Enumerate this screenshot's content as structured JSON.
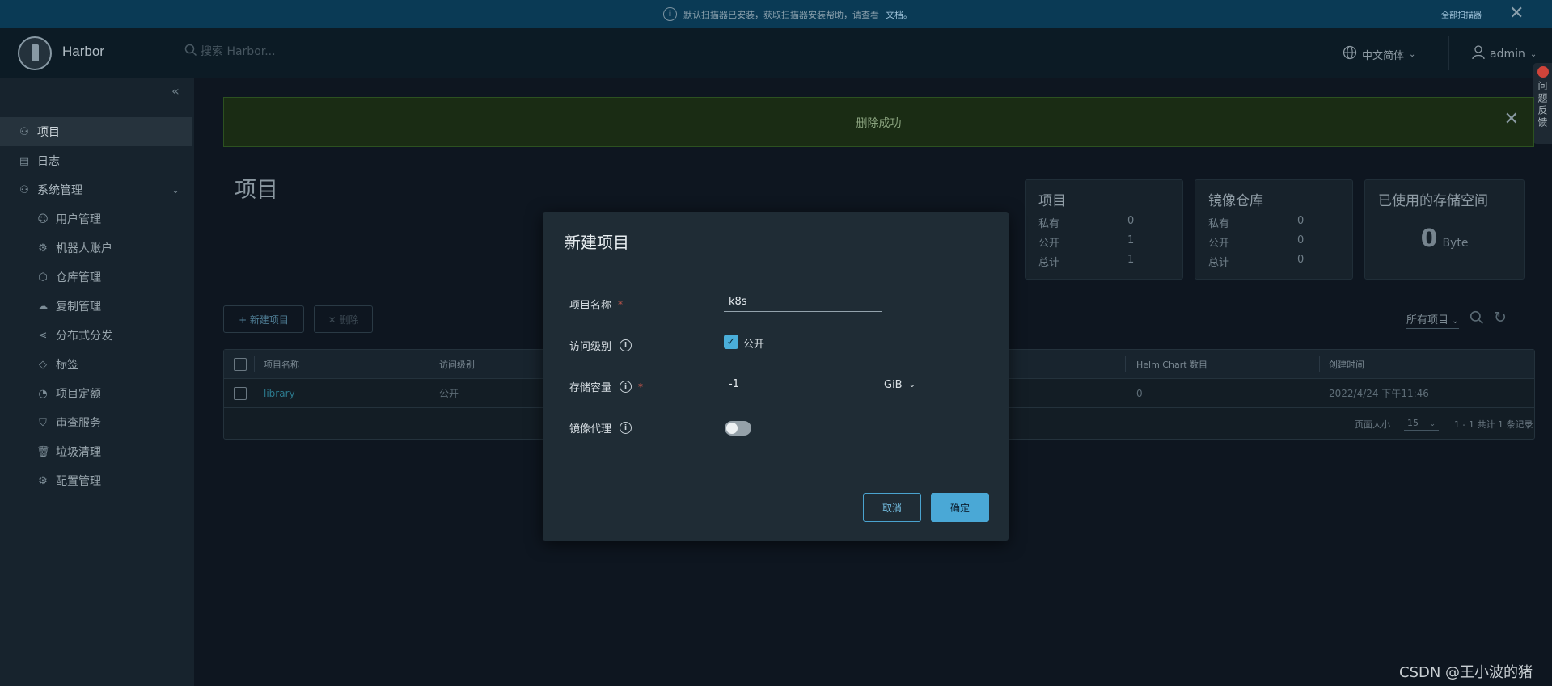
{
  "notice": {
    "message": "默认扫描器已安装，获取扫描器安装帮助，请查看",
    "doc_link": "文档。",
    "install_link": "全部扫描器"
  },
  "header": {
    "brand": "Harbor",
    "search_placeholder": "搜索 Harbor...",
    "language": "中文简体",
    "user": "admin"
  },
  "feedback": {
    "label": "问题反馈"
  },
  "sidebar": {
    "items": [
      {
        "label": "项目",
        "icon": "projects-icon",
        "active": true
      },
      {
        "label": "日志",
        "icon": "log-icon"
      },
      {
        "label": "系统管理",
        "icon": "admin-icon",
        "expandable": true
      }
    ],
    "sub_items": [
      {
        "label": "用户管理",
        "icon": "users-icon"
      },
      {
        "label": "机器人账户",
        "icon": "robot-icon"
      },
      {
        "label": "仓库管理",
        "icon": "registry-icon"
      },
      {
        "label": "复制管理",
        "icon": "replication-icon"
      },
      {
        "label": "分布式分发",
        "icon": "distribution-icon"
      },
      {
        "label": "标签",
        "icon": "tag-icon"
      },
      {
        "label": "项目定额",
        "icon": "quota-icon"
      },
      {
        "label": "审查服务",
        "icon": "shield-icon"
      },
      {
        "label": "垃圾清理",
        "icon": "trash-icon"
      },
      {
        "label": "配置管理",
        "icon": "gear-icon"
      }
    ]
  },
  "alert": {
    "message": "删除成功"
  },
  "page": {
    "title": "项目"
  },
  "cards": {
    "projects": {
      "title": "项目",
      "rows": [
        {
          "label": "私有",
          "value": "0"
        },
        {
          "label": "公开",
          "value": "1"
        },
        {
          "label": "总计",
          "value": "1"
        }
      ]
    },
    "repos": {
      "title": "镜像仓库",
      "rows": [
        {
          "label": "私有",
          "value": "0"
        },
        {
          "label": "公开",
          "value": "0"
        },
        {
          "label": "总计",
          "value": "0"
        }
      ]
    },
    "storage": {
      "title": "已使用的存储空间",
      "value": "0",
      "unit": "Byte"
    }
  },
  "toolbar": {
    "new_project": "+ 新建项目",
    "delete": "✕ 删除",
    "filter": "所有项目"
  },
  "table": {
    "headers": {
      "name": "项目名称",
      "access": "访问级别",
      "helm": "Helm Chart 数目",
      "created": "创建时间"
    },
    "rows": [
      {
        "name": "library",
        "access": "公开",
        "helm": "0",
        "created": "2022/4/24 下午11:46"
      }
    ],
    "footer": {
      "page_size_label": "页面大小",
      "page_size": "15",
      "summary": "1 - 1 共计 1 条记录"
    }
  },
  "modal": {
    "title": "新建项目",
    "name_label": "项目名称",
    "name_value": "k8s",
    "access_label": "访问级别",
    "access_checkbox_label": "公开",
    "access_checked": true,
    "quota_label": "存储容量",
    "quota_value": "-1",
    "quota_unit": "GiB",
    "proxy_label": "镜像代理",
    "proxy_enabled": false,
    "cancel": "取消",
    "ok": "确定"
  },
  "watermark": "CSDN @王小波的猪",
  "colors": {
    "accent": "#4aa8d6",
    "alert_bg": "#1a2c14",
    "sidebar_bg": "#17232d"
  }
}
